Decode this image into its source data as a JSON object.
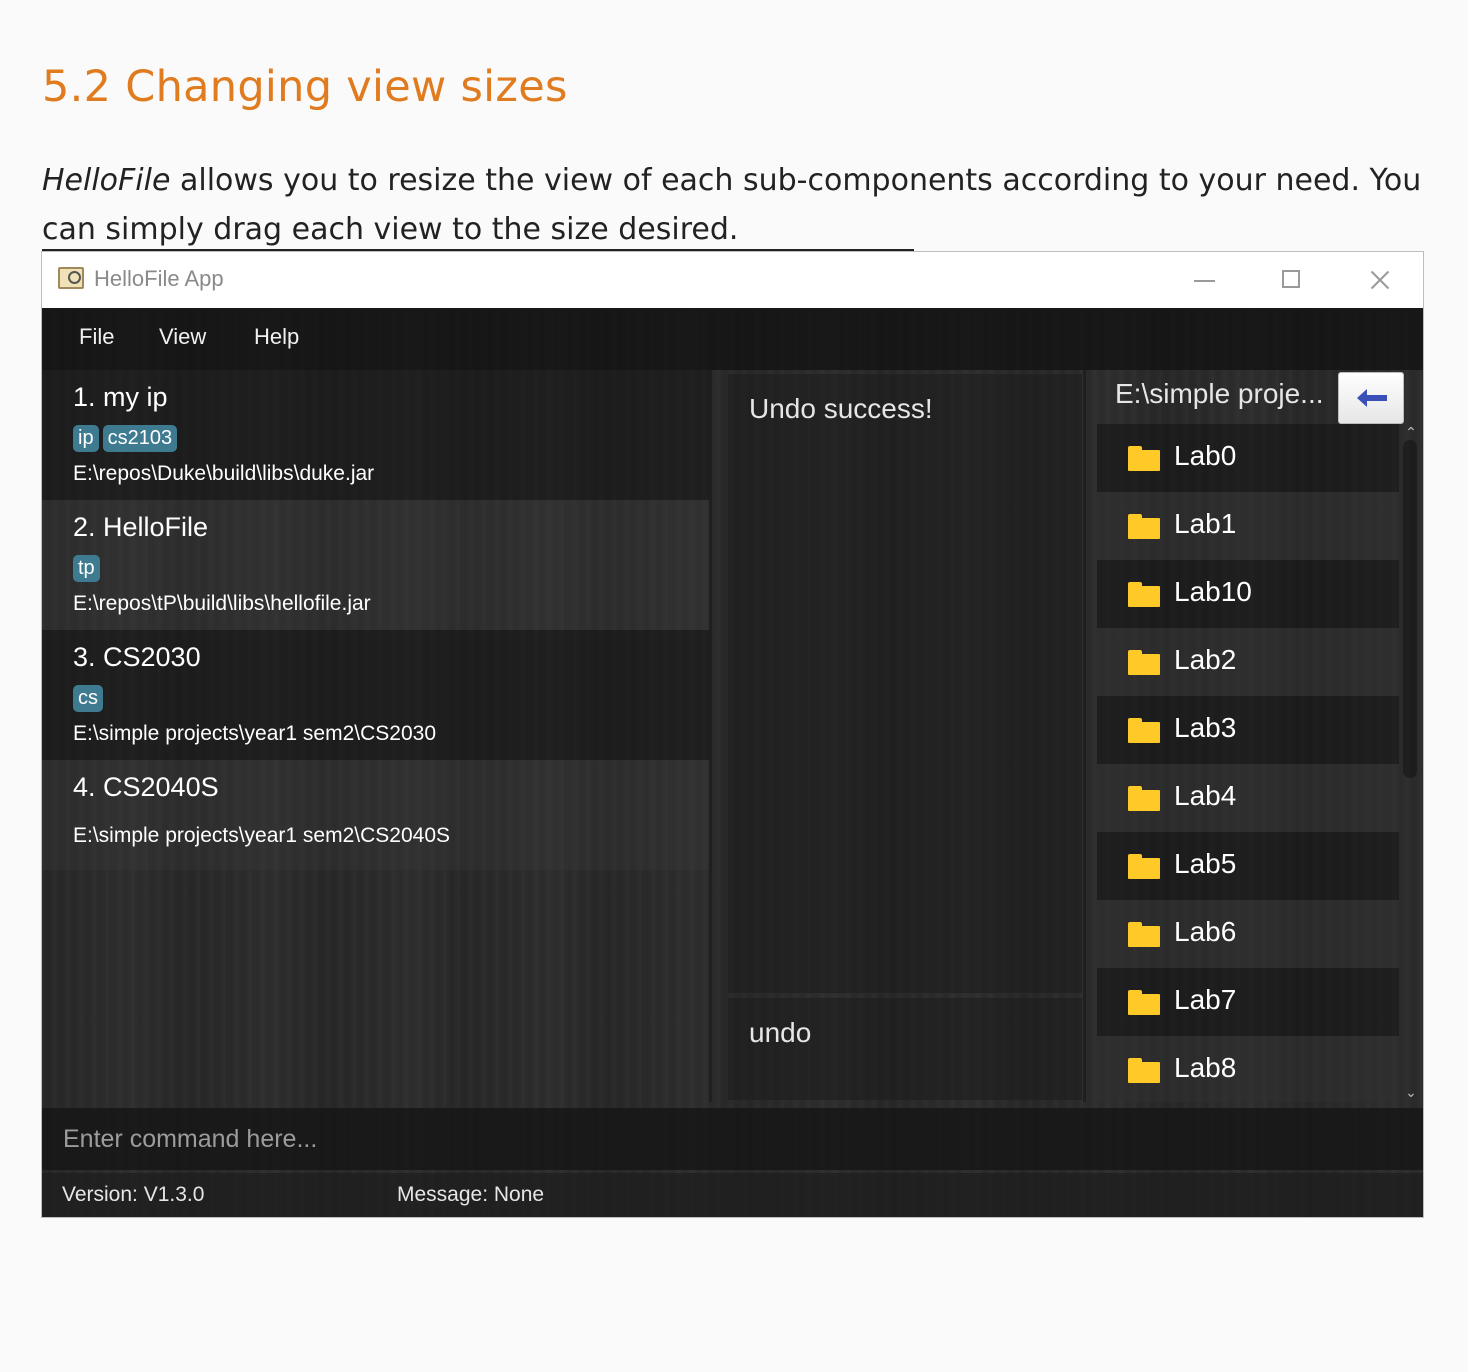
{
  "doc": {
    "heading": "5.2 Changing view sizes",
    "para_em": "HelloFile",
    "para_rest": " allows you to resize the view of each sub-components according to your need. You can simply drag each view to the size desired."
  },
  "window": {
    "title": "HelloFile App",
    "icon": "app-icon"
  },
  "menu": [
    "File",
    "View",
    "Help"
  ],
  "bookmarks": [
    {
      "title": "1.  my ip",
      "tags": [
        "ip",
        "cs2103"
      ],
      "path": "E:\\repos\\Duke\\build\\libs\\duke.jar"
    },
    {
      "title": "2.  HelloFile",
      "tags": [
        "tp"
      ],
      "path": "E:\\repos\\tP\\build\\libs\\hellofile.jar"
    },
    {
      "title": "3.  CS2030",
      "tags": [
        "cs"
      ],
      "path": "E:\\simple projects\\year1 sem2\\CS2030"
    },
    {
      "title": "4.  CS2040S",
      "tags": [],
      "path": "E:\\simple projects\\year1 sem2\\CS2040S"
    }
  ],
  "result_display": "Undo success!",
  "last_command": "undo",
  "file_panel": {
    "directory": "E:\\simple proje...",
    "back_icon": "arrow-left-icon",
    "files": [
      "Lab0",
      "Lab1",
      "Lab10",
      "Lab2",
      "Lab3",
      "Lab4",
      "Lab5",
      "Lab6",
      "Lab7",
      "Lab8"
    ]
  },
  "command": {
    "placeholder": "Enter command here...",
    "value": ""
  },
  "status": {
    "version": "Version:  V1.3.0",
    "message": "Message:  None"
  },
  "colors": {
    "heading": "#e07b1f",
    "tag": "#3e7b91",
    "folder": "#ffca28",
    "back_arrow": "#3a4fb8"
  }
}
